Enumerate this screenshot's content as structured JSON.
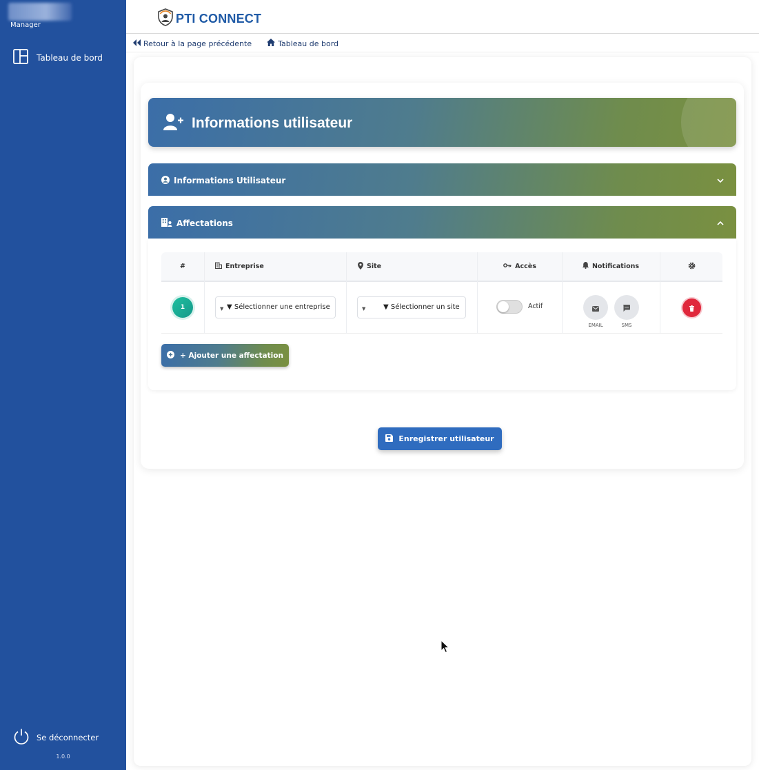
{
  "sidebar": {
    "user_role": "Manager",
    "nav": [
      {
        "label": "Tableau de bord",
        "icon": "dashboard-layout-icon"
      }
    ],
    "logout_label": "Se déconnecter",
    "version": "1.0.0",
    "bg_color": "#22519e"
  },
  "header": {
    "brand": "PTI CONNECT"
  },
  "breadcrumb": {
    "back_label": "Retour à la page précédente",
    "home_label": "Tableau de bord"
  },
  "page": {
    "title": "Informations utilisateur",
    "sections": [
      {
        "label": "Informations Utilisateur",
        "expanded": false
      },
      {
        "label": "Affectations",
        "expanded": true
      }
    ]
  },
  "affectations": {
    "columns": {
      "index": "#",
      "company": "Entreprise",
      "site": "Site",
      "access": "Accès",
      "notifications": "Notifications"
    },
    "rows": [
      {
        "index": "1",
        "company_placeholder": "▼ Sélectionner une entreprise",
        "site_placeholder": "▼ Sélectionner un site",
        "access_label": "Actif",
        "access_enabled": false,
        "email_label": "EMAIL",
        "sms_label": "SMS"
      }
    ],
    "add_label": "+ Ajouter une affectation"
  },
  "actions": {
    "save_label": "Enregistrer utilisateur"
  },
  "colors": {
    "primary": "#2f6cbf",
    "danger": "#e0283c",
    "badge": "#1fbf9f"
  }
}
